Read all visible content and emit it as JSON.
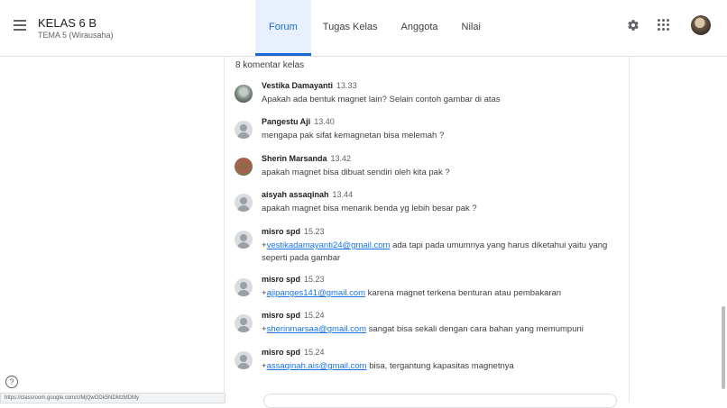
{
  "header": {
    "title": "KELAS 6 B",
    "subtitle": "TEMA 5 (Wirausaha)",
    "tabs": [
      {
        "label": "Forum",
        "active": true
      },
      {
        "label": "Tugas Kelas",
        "active": false
      },
      {
        "label": "Anggota",
        "active": false
      },
      {
        "label": "Nilai",
        "active": false
      }
    ],
    "icons": [
      "menu-icon",
      "settings-icon",
      "apps-grid-icon",
      "user-avatar"
    ]
  },
  "comments_header": "8 komentar kelas",
  "comments": [
    {
      "author": "Vestika Damayanti",
      "time": "13.33",
      "mention": "",
      "text": "Apakah ada bentuk magnet lain? Selain contoh gambar di atas",
      "avatar": "photo1"
    },
    {
      "author": "Pangestu Aji",
      "time": "13.40",
      "mention": "",
      "text": "mengapa pak sifat kemagnetan bisa melemah ?",
      "avatar": "generic"
    },
    {
      "author": "Sherin Marsanda",
      "time": "13.42",
      "mention": "",
      "text": "apakah magnet bisa dibuat sendiri oleh kita pak ?",
      "avatar": "photo2"
    },
    {
      "author": "aisyah assaqinah",
      "time": "13.44",
      "mention": "",
      "text": "apakah magnet bisa menarik benda yg lebih besar pak ?",
      "avatar": "generic"
    },
    {
      "author": "misro spd",
      "time": "15.23",
      "mention": "vestikadamayanti24@gmail.com",
      "text": " ada tapi pada umumnya yang harus diketahui yaitu yang seperti pada gambar",
      "avatar": "generic"
    },
    {
      "author": "misro spd",
      "time": "15.23",
      "mention": "ajipanges141@gmail.com",
      "text": " karena magnet terkena benturan atau pembakaran",
      "avatar": "generic"
    },
    {
      "author": "misro spd",
      "time": "15.24",
      "mention": "sherinmarsaa@gmail.com",
      "text": " sangat bisa sekali dengan cara bahan yang memumpuni",
      "avatar": "generic"
    },
    {
      "author": "misro spd",
      "time": "15.24",
      "mention": "assaqinah.ais@gmail.com",
      "text": " bisa, tergantung kapasitas magnetnya",
      "avatar": "generic"
    }
  ],
  "status_url": "https://classroom.google.com/c/MjQwODk5NDMzMDMy",
  "colors": {
    "accent": "#1967d2",
    "tab_active_bg": "#e8f0fe",
    "link": "#1a73e8"
  }
}
